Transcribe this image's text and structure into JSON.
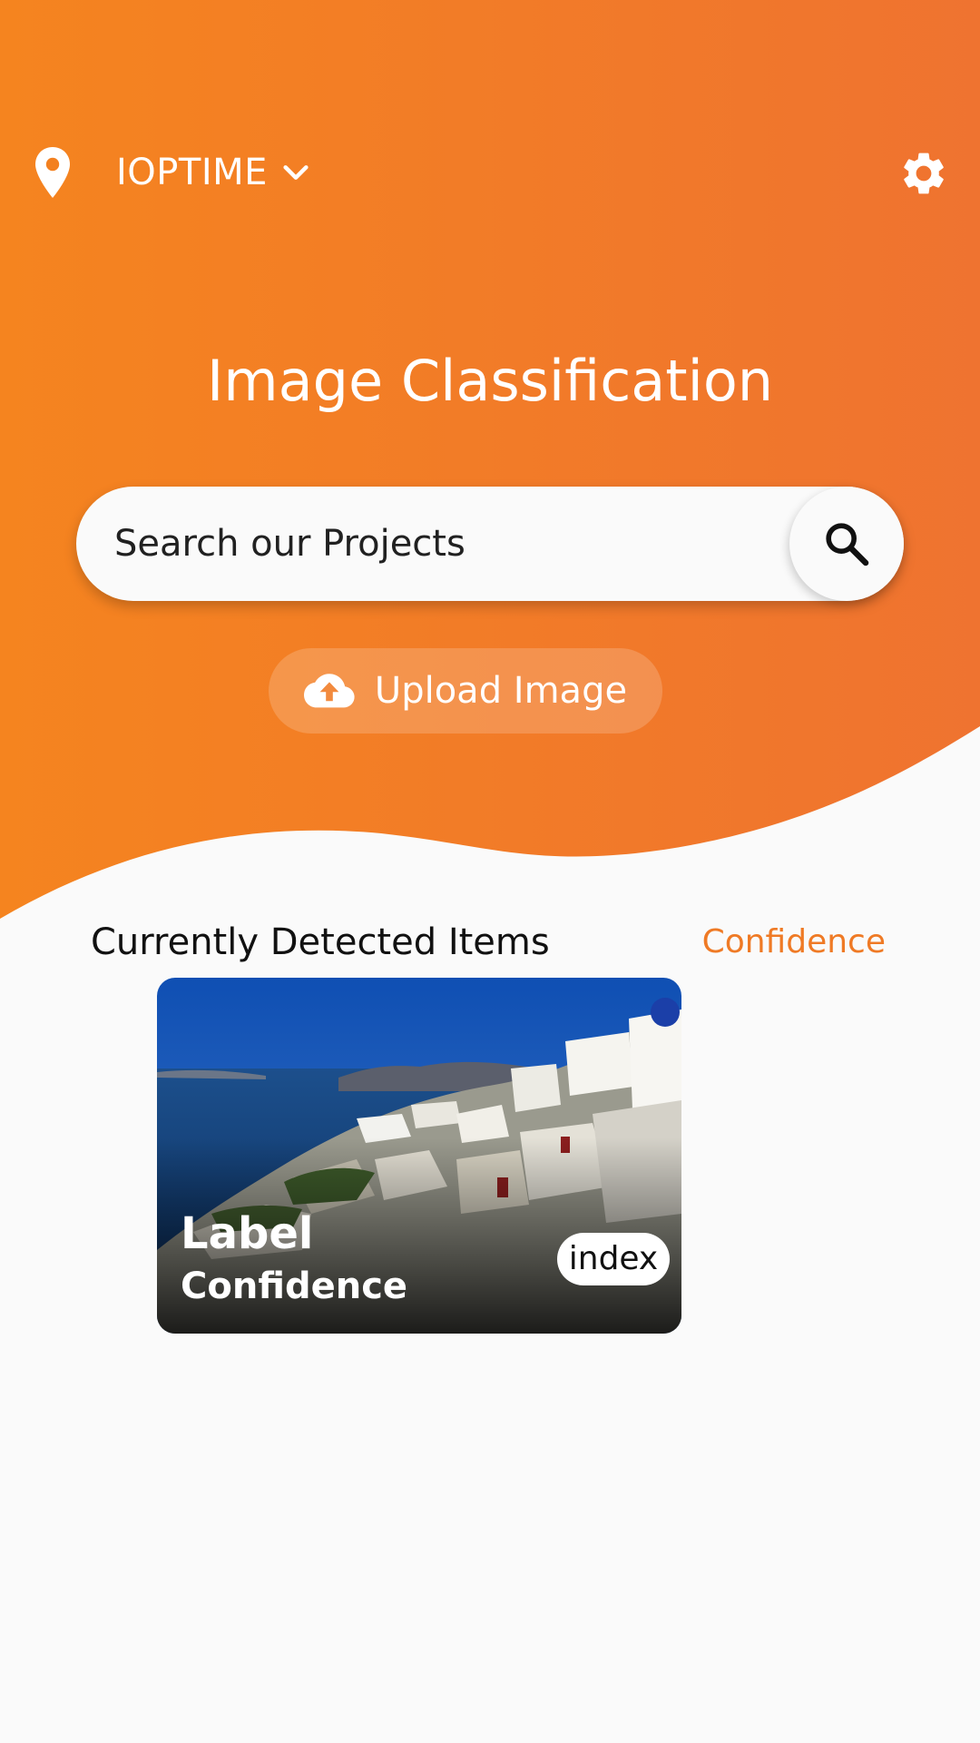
{
  "colors": {
    "header_gradient_start": "#f5841f",
    "header_gradient_end": "#ef7330",
    "accent": "#ef7a25",
    "background": "#fafafa"
  },
  "header": {
    "location": "IOPTIME",
    "location_icon": "location-pin-icon",
    "dropdown_icon": "chevron-down-icon",
    "settings_icon": "gear-icon"
  },
  "main": {
    "title": "Image Classification",
    "search": {
      "placeholder": "Search our Projects",
      "icon": "search-icon"
    },
    "upload": {
      "label": "Upload Image",
      "icon": "cloud-upload-icon"
    }
  },
  "detected": {
    "section_title": "Currently Detected Items",
    "sort_link": "Confidence",
    "items": [
      {
        "label": "Label",
        "confidence": "Confidence",
        "index": "index"
      }
    ]
  }
}
